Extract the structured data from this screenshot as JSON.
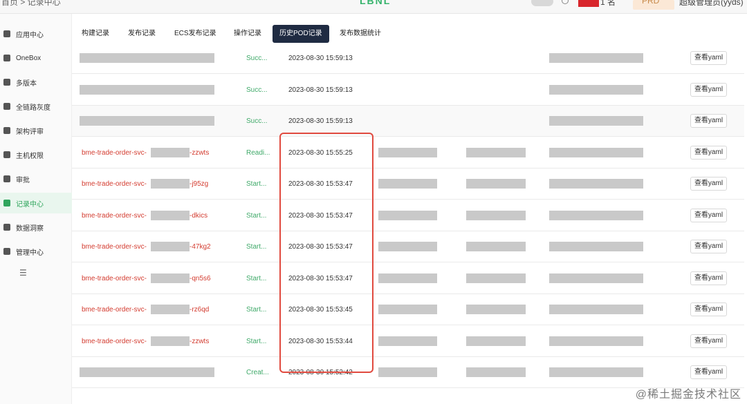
{
  "topbar": {
    "breadcrumb": "首页 > 记录中心",
    "logo": "LBNL",
    "badge": "1 名",
    "env": "PRD",
    "user": "超级管理员(yyds)"
  },
  "sidebar": {
    "items": [
      {
        "label": "应用中心",
        "icon": "app-grid-icon"
      },
      {
        "label": "OneBox",
        "icon": "onebox-icon"
      },
      {
        "label": "多版本",
        "icon": "versions-icon"
      },
      {
        "label": "全链路灰度",
        "icon": "gray-release-icon"
      },
      {
        "label": "架构评审",
        "icon": "review-icon"
      },
      {
        "label": "主机权限",
        "icon": "host-icon"
      },
      {
        "label": "审批",
        "icon": "approve-icon"
      },
      {
        "label": "记录中心",
        "icon": "records-icon"
      },
      {
        "label": "数据洞察",
        "icon": "insight-icon"
      },
      {
        "label": "管理中心",
        "icon": "admin-icon"
      }
    ],
    "active_index": 7,
    "menu_icon": "☰"
  },
  "tabs": [
    {
      "label": "构建记录"
    },
    {
      "label": "发布记录"
    },
    {
      "label": "ECS发布记录"
    },
    {
      "label": "操作记录"
    },
    {
      "label": "历史POD记录"
    },
    {
      "label": "发布数据统计"
    }
  ],
  "active_tab": 4,
  "rows": [
    {
      "name_prefix": "",
      "name_suffix": "",
      "status": "Succ...",
      "time": "2023-08-30 15:59:13",
      "action": "查看yaml"
    },
    {
      "name_prefix": "",
      "name_suffix": "",
      "status": "Succ...",
      "time": "2023-08-30 15:59:13",
      "action": "查看yaml"
    },
    {
      "name_prefix": "",
      "name_suffix": "",
      "status": "Succ...",
      "time": "2023-08-30 15:59:13",
      "action": "查看yaml"
    },
    {
      "name_prefix": "bme-trade-order-svc-",
      "name_suffix": "-zzwts",
      "status": "Readi...",
      "time": "2023-08-30 15:55:25",
      "action": "查看yaml"
    },
    {
      "name_prefix": "bme-trade-order-svc-",
      "name_suffix": "-j95zg",
      "status": "Start...",
      "time": "2023-08-30 15:53:47",
      "action": "查看yaml"
    },
    {
      "name_prefix": "bme-trade-order-svc-",
      "name_suffix": "-dkics",
      "status": "Start...",
      "time": "2023-08-30 15:53:47",
      "action": "查看yaml"
    },
    {
      "name_prefix": "bme-trade-order-svc-",
      "name_suffix": "-47kg2",
      "status": "Start...",
      "time": "2023-08-30 15:53:47",
      "action": "查看yaml"
    },
    {
      "name_prefix": "bme-trade-order-svc-",
      "name_suffix": "-qn5s6",
      "status": "Start...",
      "time": "2023-08-30 15:53:47",
      "action": "查看yaml"
    },
    {
      "name_prefix": "bme-trade-order-svc-",
      "name_suffix": "-rz6qd",
      "status": "Start...",
      "time": "2023-08-30 15:53:45",
      "action": "查看yaml"
    },
    {
      "name_prefix": "bme-trade-order-svc-",
      "name_suffix": "-zzwts",
      "status": "Start...",
      "time": "2023-08-30 15:53:44",
      "action": "查看yaml"
    },
    {
      "name_prefix": "",
      "name_suffix": "",
      "status": "Creat...",
      "time": "2023-08-30 15:52:42",
      "action": "查看yaml"
    }
  ],
  "watermark": "@稀土掘金技术社区",
  "colors": {
    "accent": "#2fa55c",
    "tab_active": "#1f2b42",
    "name_red": "#d33b2f",
    "highlight": "#e0493e"
  }
}
